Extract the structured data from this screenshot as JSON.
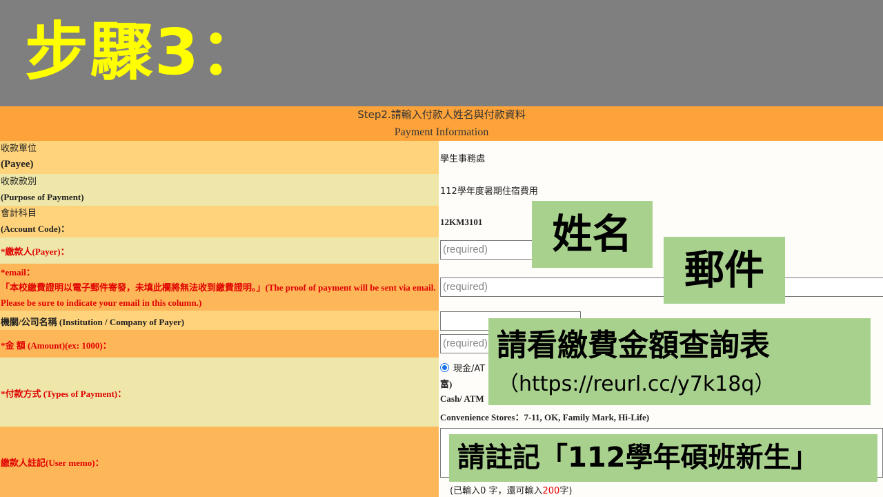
{
  "banner": {
    "title": "步驟3："
  },
  "form_header": {
    "line1": "Step2.請輸入付款人姓名與付款資料",
    "line2": "Payment Information"
  },
  "rows": {
    "payee": {
      "label_cn": "收款單位",
      "label_en": "(Payee)",
      "value": "學生事務處"
    },
    "purpose": {
      "label_cn": "收款款別",
      "label_en": "(Purpose of Payment)",
      "value": "112學年度暑期住宿費用"
    },
    "account": {
      "label_cn": "會計科目",
      "label_en": "(Account Code)：",
      "value": "12KM3101"
    },
    "payer": {
      "label": "*繳款人(Payer)：",
      "placeholder": "(required)"
    },
    "email": {
      "label": "*email：",
      "note": "「本校繳費證明以電子郵件寄發，未填此欄將無法收到繳費證明。」(The proof of payment will be sent via email. Please be sure to indicate your email in this column.)",
      "placeholder": "(required)"
    },
    "institution": {
      "label": "機關/公司名稱 (Institution / Company of Payer)"
    },
    "amount": {
      "label": "*金 額 (Amount)(ex: 1000)：",
      "placeholder": "(required)"
    },
    "payment_type": {
      "label": "*付款方式 (Types of Payment)：",
      "option_line1": "現金/AT",
      "option_line2": "富)",
      "option_line3": "Cash/ ATM",
      "option_line4": "Convenience Stores：7-11, OK, Family Mark, Hi-Life)"
    },
    "memo": {
      "label": "繳款人註記(User memo)：",
      "counter_prefix": "(已輸入0 字，還可輸入",
      "counter_num": "200",
      "counter_suffix": "字)"
    }
  },
  "overlays": {
    "name": "姓名",
    "email": "郵件",
    "amount_line1": "請看繳費金額查詢表",
    "amount_line2": "（https://reurl.cc/y7k18q）",
    "memo": "請註記「112學年碩班新生」"
  }
}
